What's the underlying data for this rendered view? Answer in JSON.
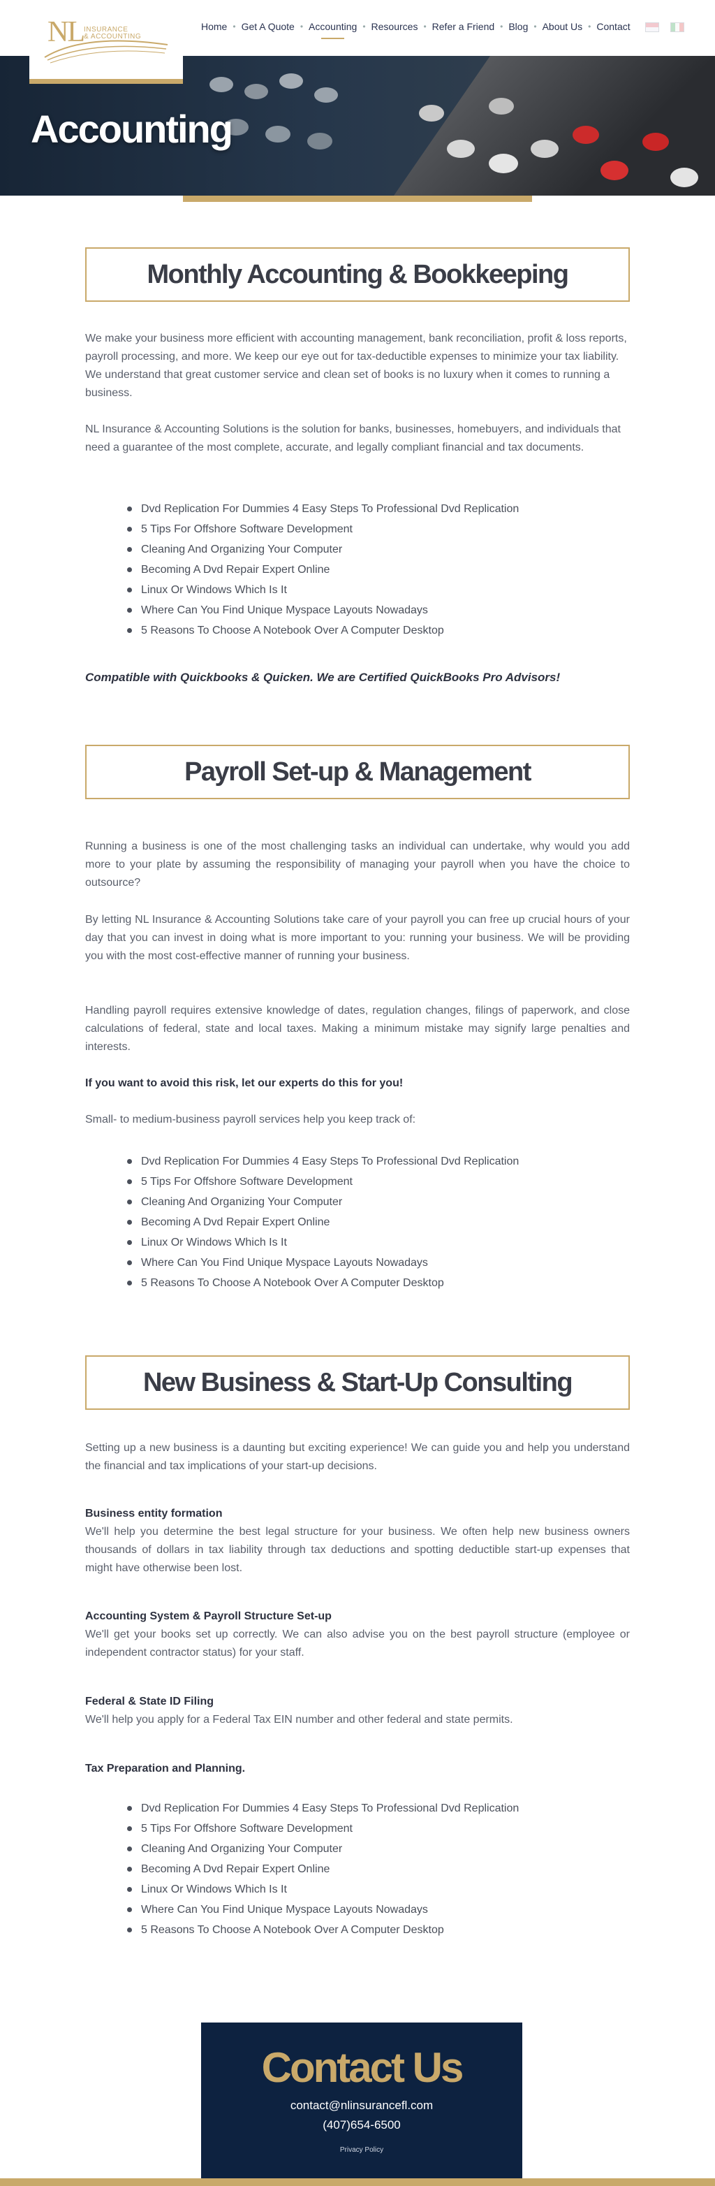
{
  "header": {
    "logo_letters": "NL",
    "logo_line1": "INSURANCE",
    "logo_line2": "& ACCOUNTING",
    "nav": [
      "Home",
      "Get A Quote",
      "Accounting",
      "Resources",
      "Refer a Friend",
      "Blog",
      "About Us",
      "Contact"
    ],
    "active_nav": "Accounting"
  },
  "hero": {
    "title": "Accounting"
  },
  "section1": {
    "title": "Monthly Accounting & Bookkeeping",
    "p1": "We make your business more efficient with accounting management, bank reconciliation, profit & loss reports, payroll processing, and more. We keep our eye out for tax-deductible expenses to minimize your tax liability. We understand that great customer service and clean set of books is no luxury when it comes to running a business.",
    "p2": "NL Insurance & Accounting Solutions is the solution for banks, businesses, homebuyers, and individuals that need a guarantee of the most complete, accurate, and legally compliant financial and tax documents.",
    "bullets": [
      "Dvd Replication For Dummies 4 Easy Steps To Professional Dvd Replication",
      "5 Tips For Offshore Software Development",
      "Cleaning And Organizing Your Computer",
      "Becoming A Dvd Repair Expert Online",
      "Linux Or Windows Which Is It",
      "Where Can You Find Unique Myspace Layouts Nowadays",
      "5 Reasons To Choose A Notebook Over A Computer Desktop"
    ],
    "note": "Compatible with Quickbooks & Quicken.  We are Certified QuickBooks Pro Advisors!"
  },
  "section2": {
    "title": "Payroll Set-up & Management",
    "p1": "Running a business is one of the most challenging tasks an individual can undertake, why would you add more to your plate by assuming the responsibility of managing your payroll when you have the choice to outsource?",
    "p2": "By letting NL Insurance & Accounting Solutions take care of your payroll you can free up crucial hours of your day that you can invest in doing what is more important to you: running your business. We will be providing you with the most cost-effective manner of running your business.",
    "p3": "Handling payroll requires extensive knowledge of dates, regulation changes, filings of paperwork, and close calculations of federal, state and local taxes. Making a minimum mistake may signify large penalties and interests.",
    "p4": "If you want to avoid this risk, let our experts do this for you!",
    "p5": "Small- to medium-business payroll services help you keep track of:",
    "bullets": [
      "Dvd Replication For Dummies 4 Easy Steps To Professional Dvd Replication",
      "5 Tips For Offshore Software Development",
      "Cleaning And Organizing Your Computer",
      "Becoming A Dvd Repair Expert Online",
      "Linux Or Windows Which Is It",
      "Where Can You Find Unique Myspace Layouts Nowadays",
      "5 Reasons To Choose A Notebook Over A Computer Desktop"
    ]
  },
  "section3": {
    "title": "New Business & Start-Up Consulting",
    "intro": "Setting up a new business is a daunting but exciting experience! We can guide you and help you understand the financial and tax implications of your start-up decisions.",
    "h1": "Business entity formation",
    "t1": "We'll help you determine the best legal structure for your business. We often help new business owners thousands of dollars in tax liability through tax deductions and spotting deductible start-up expenses that might have otherwise been lost.",
    "h2": "Accounting System & Payroll Structure Set-up",
    "t2": "We'll get your books set up correctly. We can also advise you on the best payroll structure (employee or independent contractor status) for your staff.",
    "h3": "Federal & State ID Filing",
    "t3": "We'll help you apply for a Federal Tax EIN number and other federal and state permits.",
    "h4": "Tax Preparation and Planning.",
    "bullets": [
      "Dvd Replication For Dummies 4 Easy Steps To Professional Dvd Replication",
      "5 Tips For Offshore Software Development",
      "Cleaning And Organizing Your Computer",
      "Becoming A Dvd Repair Expert Online",
      "Linux Or Windows Which Is It",
      "Where Can You Find Unique Myspace Layouts Nowadays",
      "5 Reasons To Choose A Notebook Over A Computer Desktop"
    ]
  },
  "contact": {
    "title": "Contact Us",
    "email": "contact@nlinsurancefl.com",
    "phone": "(407)654-6500",
    "privacy": "Privacy Policy"
  },
  "colors": {
    "gold": "#c9a96a",
    "navy": "#0d2240",
    "text": "#555a66"
  }
}
